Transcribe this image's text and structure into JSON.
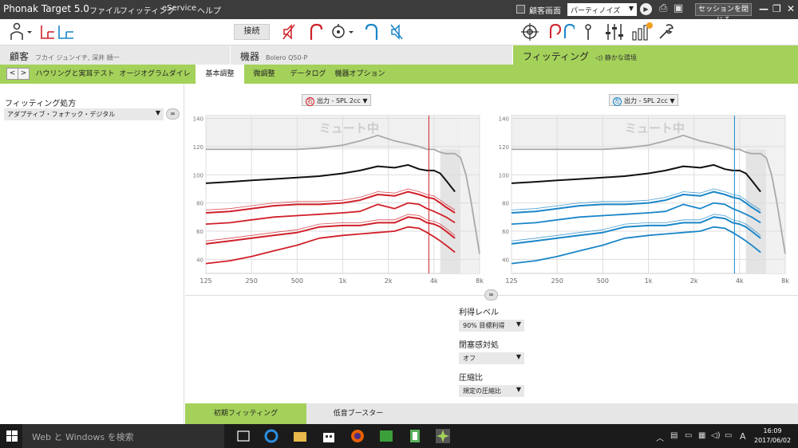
{
  "titlebar": {
    "app_title": "Phonak Target 5.0",
    "menus": [
      "ファイル",
      "フィッティング",
      "eService",
      "ヘルプ"
    ],
    "client_screen_label": "顧客画面",
    "environment_select": "パーティノイズ",
    "close_session_label": "セッションを閉じる"
  },
  "toolbar": {
    "connect_label": "接続"
  },
  "header": {
    "client_label": "顧客",
    "client_name": "フカイ ジュンイチ, 深井 順一",
    "device_label": "機器",
    "device_name": "Bolero Q50-P",
    "fitting_label": "フィッティング",
    "fitting_env": "静かな環境"
  },
  "tabs": {
    "items": [
      "ハウリングと実耳テスト",
      "オージオグラムダイレクト",
      "基本調整",
      "微調整",
      "データログ",
      "機器オプション"
    ],
    "active_index": 2
  },
  "left_panel": {
    "prescription_label": "フィッティング処方",
    "prescription_value": "アダプティブ・フォナック・デジタル"
  },
  "charts": {
    "right_ear_badge": "右",
    "left_ear_badge": "左",
    "right_title": "出力 - SPL 2cc",
    "left_title": "出力 - SPL 2cc",
    "mute_text": "ミュート中",
    "colors": {
      "right": "#d0202a",
      "left": "#1a86c8",
      "black": "#111111",
      "gray": "#a9a9a9"
    }
  },
  "chart_data": [
    {
      "type": "line",
      "ear": "right",
      "title": "出力 - SPL 2cc",
      "xscale": "log",
      "x": [
        125,
        250,
        500,
        1000,
        2000,
        4000,
        8000
      ],
      "x_tick_labels": [
        "125",
        "250",
        "500",
        "1k",
        "2k",
        "4k",
        "8k"
      ],
      "y_ticks": [
        40,
        60,
        80,
        100,
        120,
        140
      ],
      "ylim": [
        30,
        142
      ],
      "series": [
        {
          "x": [
            125,
            180,
            250,
            350,
            500,
            700,
            1000,
            1300,
            1700,
            2200,
            2700,
            3200,
            3600,
            4000,
            4400,
            4800,
            5500,
            6000,
            6500,
            7000,
            8000
          ],
          "values": [
            118,
            118,
            118,
            118,
            118,
            119,
            121,
            124,
            128,
            124,
            122,
            120,
            118,
            118,
            116,
            115,
            115,
            112,
            100,
            82,
            44
          ]
        },
        {
          "x": [
            125,
            180,
            250,
            350,
            500,
            700,
            1000,
            1300,
            1700,
            2200,
            2700,
            3200,
            3600,
            4000,
            4400,
            4800,
            5500
          ],
          "values": [
            94,
            95,
            96,
            97,
            98,
            99,
            101,
            103,
            106,
            105,
            107,
            104,
            103,
            103,
            101,
            96,
            88
          ]
        },
        {
          "x": [
            125,
            180,
            250,
            350,
            500,
            700,
            1000,
            1300,
            1700,
            2200,
            2700,
            3200,
            3600,
            4000,
            4400,
            4800,
            5500
          ],
          "values": [
            73,
            74,
            76,
            78,
            79,
            79,
            80,
            82,
            86,
            85,
            88,
            86,
            84,
            83,
            80,
            77,
            73
          ]
        },
        {
          "x": [
            125,
            180,
            250,
            350,
            500,
            700,
            1000,
            1300,
            1700,
            2200,
            2700,
            3200,
            3600,
            4000,
            4400,
            4800,
            5500
          ],
          "values": [
            65,
            66,
            68,
            70,
            71,
            72,
            73,
            74,
            79,
            76,
            80,
            79,
            76,
            74,
            72,
            70,
            66
          ]
        },
        {
          "x": [
            125,
            180,
            250,
            350,
            500,
            700,
            1000,
            1300,
            1700,
            2200,
            2700,
            3200,
            3600,
            4000,
            4400,
            4800,
            5500
          ],
          "values": [
            51,
            53,
            55,
            57,
            59,
            63,
            64,
            64,
            66,
            66,
            70,
            69,
            66,
            65,
            63,
            60,
            55
          ]
        },
        {
          "x": [
            125,
            180,
            250,
            350,
            500,
            700,
            1000,
            1300,
            1700,
            2200,
            2700,
            3200,
            3600,
            4000,
            4400,
            4800,
            5500
          ],
          "values": [
            37,
            39,
            42,
            46,
            50,
            55,
            57,
            58,
            59,
            60,
            63,
            62,
            59,
            56,
            53,
            50,
            45
          ]
        }
      ]
    },
    {
      "type": "line",
      "ear": "left",
      "title": "出力 - SPL 2cc",
      "xscale": "log",
      "x": [
        125,
        250,
        500,
        1000,
        2000,
        4000,
        8000
      ],
      "x_tick_labels": [
        "125",
        "250",
        "500",
        "1k",
        "2k",
        "4k",
        "8k"
      ],
      "y_ticks": [
        40,
        60,
        80,
        100,
        120,
        140
      ],
      "ylim": [
        30,
        142
      ],
      "series": [
        {
          "x": [
            125,
            180,
            250,
            350,
            500,
            700,
            1000,
            1300,
            1700,
            2200,
            2700,
            3200,
            3600,
            4000,
            4400,
            4800,
            5500,
            6000,
            6500,
            7000,
            8000
          ],
          "values": [
            118,
            118,
            118,
            118,
            118,
            119,
            121,
            124,
            128,
            124,
            122,
            120,
            118,
            118,
            116,
            115,
            115,
            112,
            100,
            82,
            44
          ]
        },
        {
          "x": [
            125,
            180,
            250,
            350,
            500,
            700,
            1000,
            1300,
            1700,
            2200,
            2700,
            3200,
            3600,
            4000,
            4400,
            4800,
            5500
          ],
          "values": [
            94,
            95,
            96,
            97,
            98,
            99,
            101,
            103,
            106,
            105,
            107,
            104,
            103,
            103,
            101,
            96,
            88
          ]
        },
        {
          "x": [
            125,
            180,
            250,
            350,
            500,
            700,
            1000,
            1300,
            1700,
            2200,
            2700,
            3200,
            3600,
            4000,
            4400,
            4800,
            5500
          ],
          "values": [
            73,
            74,
            76,
            78,
            79,
            79,
            80,
            82,
            86,
            85,
            88,
            86,
            84,
            83,
            80,
            77,
            73
          ]
        },
        {
          "x": [
            125,
            180,
            250,
            350,
            500,
            700,
            1000,
            1300,
            1700,
            2200,
            2700,
            3200,
            3600,
            4000,
            4400,
            4800,
            5500
          ],
          "values": [
            65,
            66,
            68,
            70,
            71,
            72,
            73,
            74,
            79,
            76,
            80,
            79,
            76,
            74,
            72,
            70,
            66
          ]
        },
        {
          "x": [
            125,
            180,
            250,
            350,
            500,
            700,
            1000,
            1300,
            1700,
            2200,
            2700,
            3200,
            3600,
            4000,
            4400,
            4800,
            5500
          ],
          "values": [
            51,
            53,
            55,
            57,
            59,
            63,
            64,
            64,
            66,
            66,
            70,
            69,
            66,
            65,
            63,
            60,
            55
          ]
        },
        {
          "x": [
            125,
            180,
            250,
            350,
            500,
            700,
            1000,
            1300,
            1700,
            2200,
            2700,
            3200,
            3600,
            4000,
            4400,
            4800,
            5500
          ],
          "values": [
            37,
            39,
            42,
            46,
            50,
            55,
            57,
            58,
            59,
            60,
            63,
            62,
            59,
            56,
            53,
            50,
            45
          ]
        }
      ]
    }
  ],
  "controls": {
    "gain_label": "利得レベル",
    "gain_value": "90% 目標利得",
    "occlusion_label": "閉塞感対処",
    "occlusion_value": "オフ",
    "compression_label": "圧縮比",
    "compression_value": "規定の圧縮比"
  },
  "bottom_tabs": [
    "初期フィッティング",
    "低音ブースター"
  ],
  "taskbar": {
    "search_placeholder": "Web と Windows を検索",
    "ime": "A",
    "time": "16:09",
    "date": "2017/06/02"
  }
}
